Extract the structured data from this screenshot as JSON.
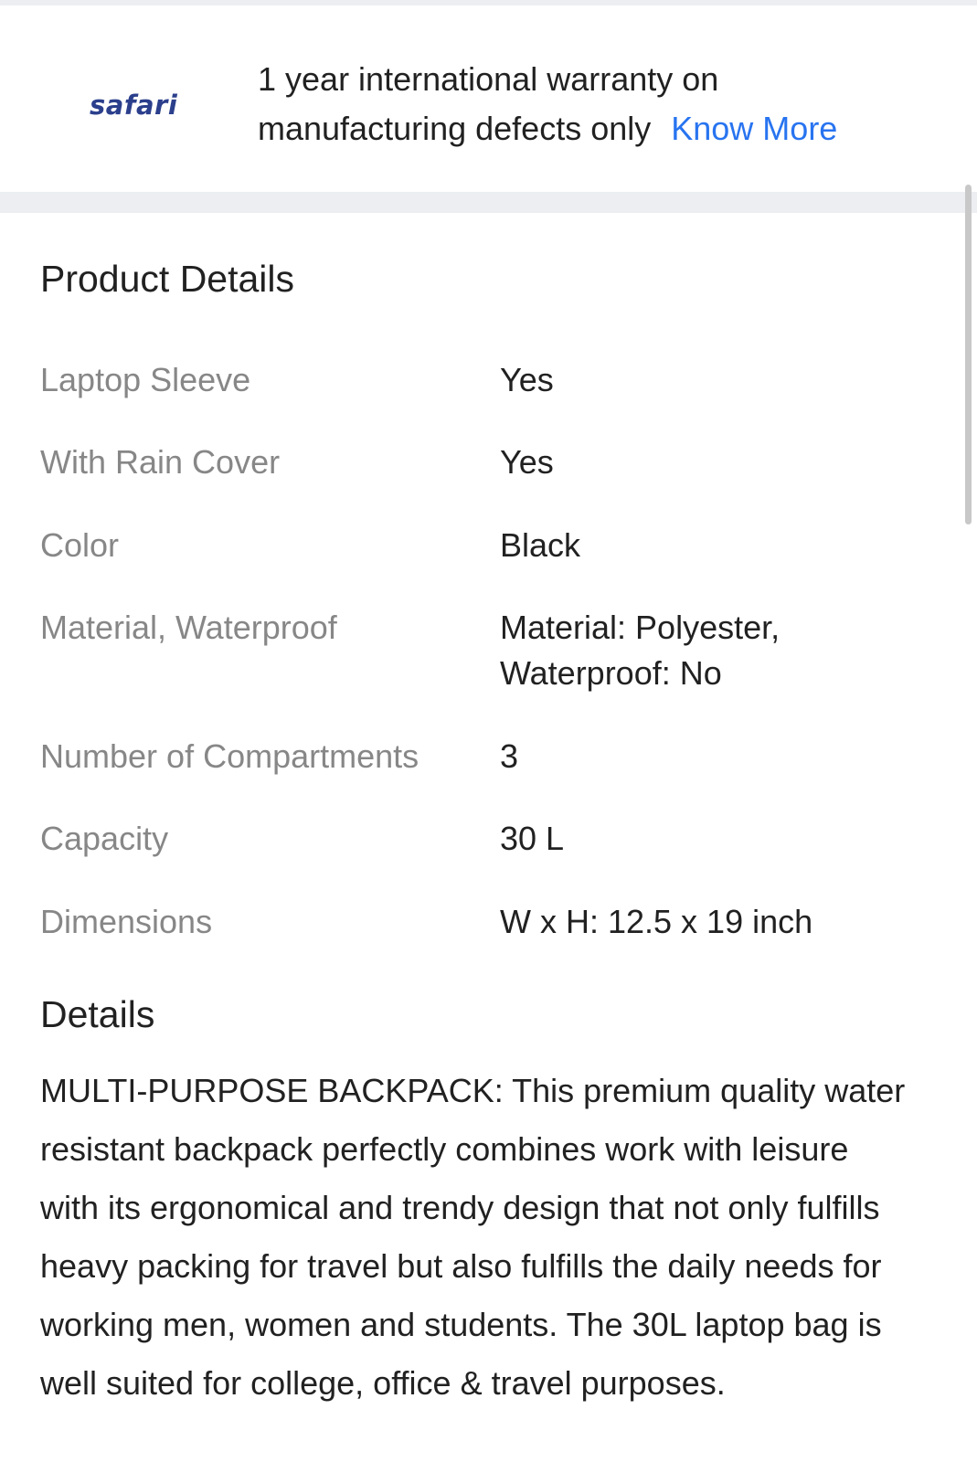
{
  "warranty": {
    "brand_logo_text": "safari",
    "text_line1": "1 year international warranty on",
    "text_line2": "manufacturing defects only",
    "link_label": "Know More",
    "link_color": "#2874f0"
  },
  "product_details": {
    "title": "Product Details",
    "specs": [
      {
        "label": "Laptop Sleeve",
        "value": "Yes"
      },
      {
        "label": "With Rain Cover",
        "value": "Yes"
      },
      {
        "label": "Color",
        "value": "Black"
      },
      {
        "label": "Material, Waterproof",
        "value_line1": "Material: Polyester,",
        "value_line2": "Waterproof: No"
      },
      {
        "label": "Number of Compartments",
        "value": "3"
      },
      {
        "label": "Capacity",
        "value": "30 L"
      },
      {
        "label": "Dimensions",
        "value": "W x H: 12.5 x 19 inch"
      }
    ]
  },
  "details": {
    "title": "Details",
    "lines": [
      "MULTI-PURPOSE BACKPACK: This premium quality water",
      "resistant backpack perfectly combines work with leisure",
      "with its ergonomical and trendy design that not only fulfills",
      "heavy packing for travel but also fulfills the daily needs for",
      "working men, women and students. The 30L laptop bag is",
      "well suited for college, office & travel purposes."
    ]
  }
}
